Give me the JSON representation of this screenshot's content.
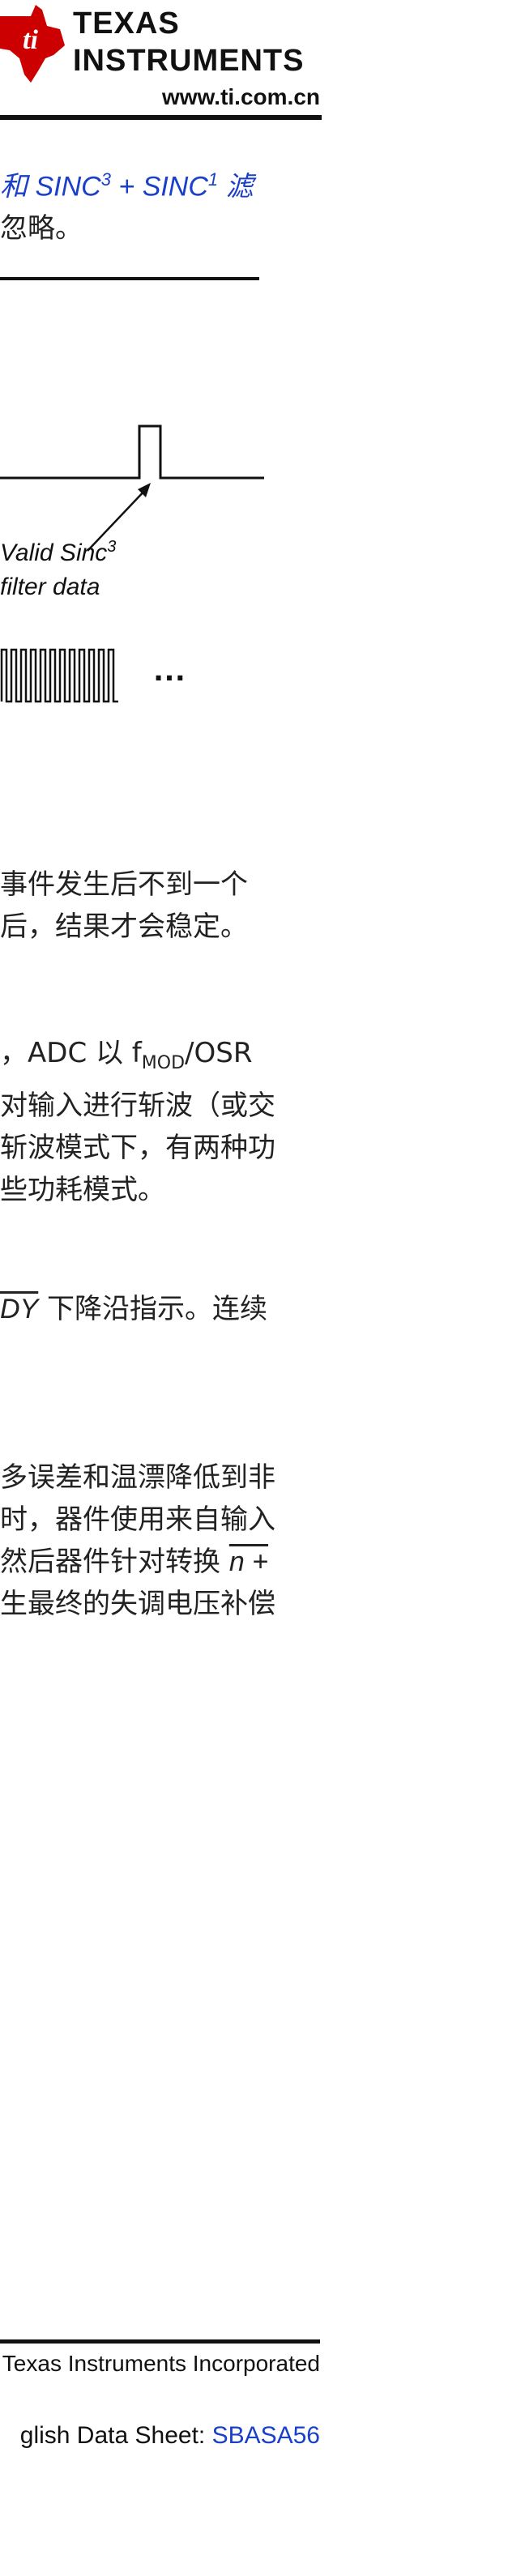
{
  "header": {
    "brand_line1": "TEXAS",
    "brand_line2": "INSTRUMENTS",
    "website": "www.ti.com.cn"
  },
  "intro": {
    "line1_prefix": "和 ",
    "line1_sinc3": "SINC",
    "line1_sinc3_sup": "3",
    "line1_mid": " + ",
    "line1_sinc1": "SINC",
    "line1_sinc1_sup": "1",
    "line1_suffix": " 滤",
    "line2": "忽略。"
  },
  "figure": {
    "label_line1": "Valid Sinc",
    "label_line1_sup": "3",
    "label_line2": "filter data",
    "ellipsis": "…"
  },
  "paragraphs": {
    "p1_line1": "事件发生后不到一个",
    "p1_line2": "后，结果才会稳定。",
    "p2_line1_a": "，ADC 以 f",
    "p2_line1_sub": "MOD",
    "p2_line1_b": "/OSR",
    "p2_line2": "对输入进行斩波（或交",
    "p2_line3": "斩波模式下，有两种功",
    "p2_line4": "些功耗模式。",
    "p3_line1_over": "DY",
    "p3_line1_rest": " 下降沿指示。连续",
    "p4_line1": "多误差和温漂降低到非",
    "p4_line2": "时，器件使用来自输入",
    "p4_line3_a": "然后器件针对转换 ",
    "p4_line3_over": "n +",
    "p4_line4": "生最终的失调电压补偿"
  },
  "footer": {
    "copyright": "Texas Instruments Incorporated",
    "source_prefix": "glish Data Sheet: ",
    "source_link": "SBASA56"
  }
}
